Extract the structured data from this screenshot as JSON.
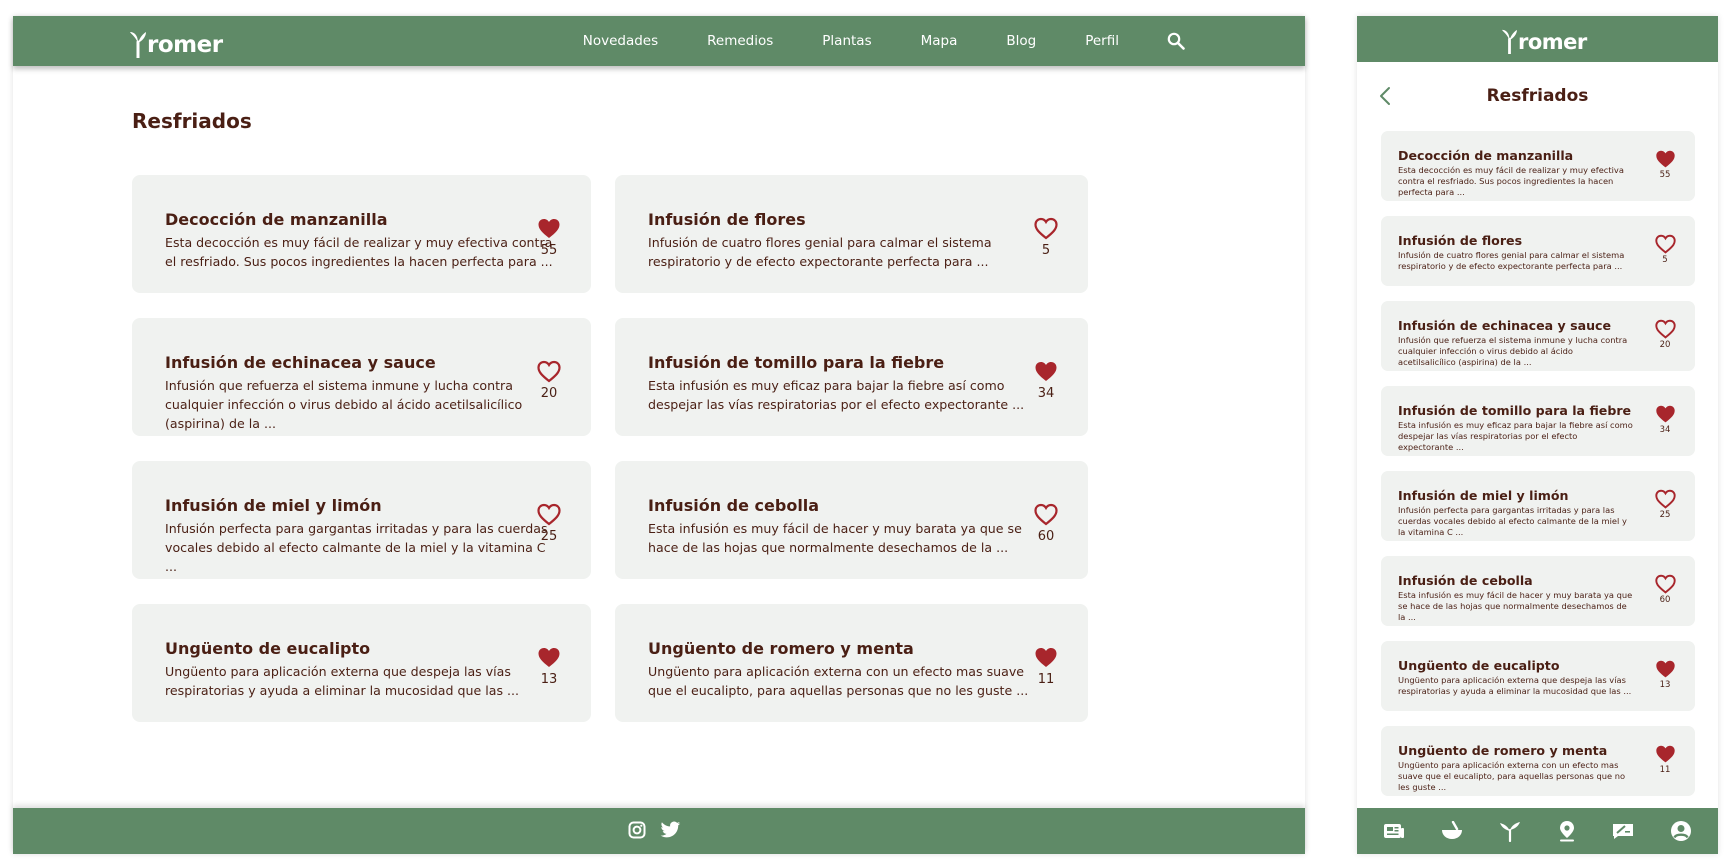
{
  "brand": {
    "logo_text": "romer"
  },
  "colors": {
    "header": "#5f8a67",
    "card": "#f0f2f0",
    "text": "#4a1f14",
    "heart": "#a8262c"
  },
  "nav": {
    "items": [
      "Novedades",
      "Remedios",
      "Plantas",
      "Mapa",
      "Blog",
      "Perfil"
    ],
    "search_icon": "search-icon"
  },
  "page": {
    "title": "Resfriados"
  },
  "remedies": [
    {
      "title": "Decocción de manzanilla",
      "desc": "Esta decocción es muy fácil de realizar y muy efectiva contra el resfriado. Sus pocos ingredientes la hacen perfecta para ...",
      "likes": "55",
      "liked": true
    },
    {
      "title": "Infusión de flores",
      "desc": "Infusión de cuatro flores genial para calmar el sistema respiratorio y de efecto expectorante perfecta para ...",
      "likes": "5",
      "liked": false
    },
    {
      "title": "Infusión de echinacea y sauce",
      "desc": "Infusión que refuerza el sistema inmune y lucha contra cualquier infección o virus debido al ácido acetilsalicílico (aspirina) de la ...",
      "likes": "20",
      "liked": false
    },
    {
      "title": "Infusión de tomillo para la fiebre",
      "desc": "Esta infusión es muy eficaz para bajar la fiebre así como despejar las vías respiratorias por el efecto expectorante ...",
      "likes": "34",
      "liked": true
    },
    {
      "title": "Infusión de miel y limón",
      "desc": "Infusión  perfecta para gargantas irritadas y para las cuerdas vocales debido al efecto calmante de la miel y la vitamina C ...",
      "likes": "25",
      "liked": false
    },
    {
      "title": "Infusión de cebolla",
      "desc": "Esta infusión es muy fácil de hacer y muy barata ya que se hace de las hojas que normalmente desechamos de la ...",
      "likes": "60",
      "liked": false
    },
    {
      "title": "Ungüento de eucalipto",
      "desc": "Ungüento para aplicación externa que despeja las vías respiratorias y ayuda a eliminar la mucosidad que las ...",
      "likes": "13",
      "liked": true
    },
    {
      "title": "Ungüento de romero y menta",
      "desc": "Ungüento para aplicación externa con un efecto mas suave que el eucalipto, para aquellas personas que no les guste ...",
      "likes": "11",
      "liked": true
    }
  ],
  "footer": {
    "social_icons": [
      "instagram-icon",
      "twitter-icon"
    ]
  },
  "mobile_tabbar": {
    "icons": [
      "news-icon",
      "mortar-icon",
      "sprout-icon",
      "map-pin-icon",
      "blog-icon",
      "profile-icon"
    ]
  }
}
